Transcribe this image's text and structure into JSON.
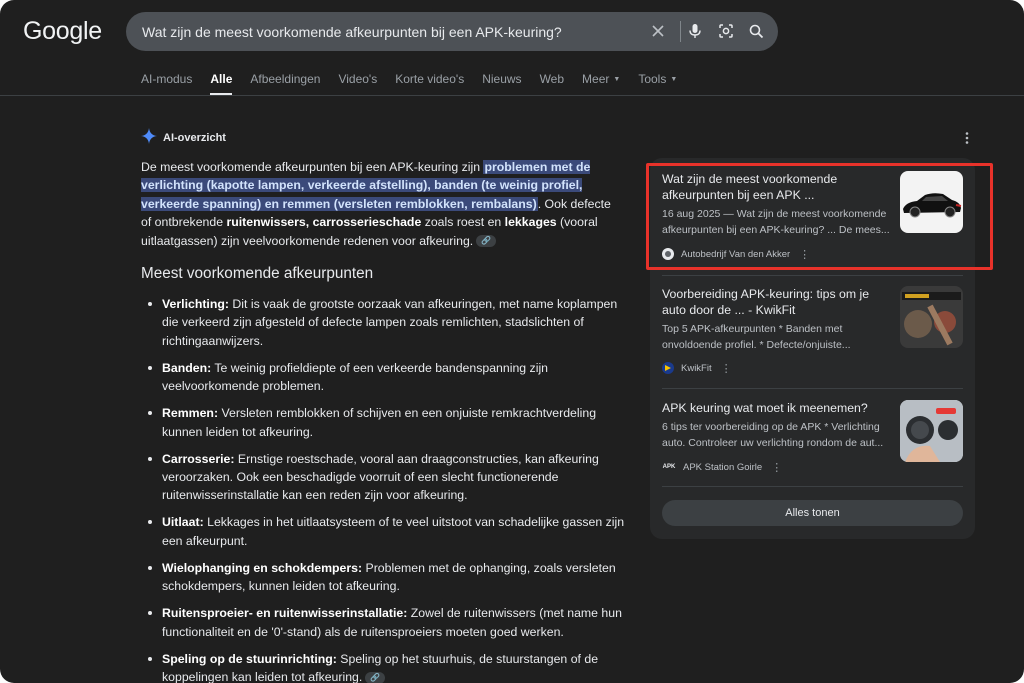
{
  "header": {
    "logo": "Google",
    "search_value": "Wat zijn de meest voorkomende afkeurpunten bij een APK-keuring?"
  },
  "tabs": [
    {
      "label": "AI-modus"
    },
    {
      "label": "Alle",
      "active": true
    },
    {
      "label": "Afbeeldingen"
    },
    {
      "label": "Video's"
    },
    {
      "label": "Korte video's"
    },
    {
      "label": "Nieuws"
    },
    {
      "label": "Web"
    },
    {
      "label": "Meer",
      "caret": true
    },
    {
      "label": "Tools",
      "caret": true
    }
  ],
  "ai_overview": {
    "title": "AI-overzicht",
    "summary": {
      "p1": "De meest voorkomende afkeurpunten bij een APK-keuring zijn ",
      "hl": "problemen met de verlichting (kapotte lampen, verkeerde afstelling), banden (te weinig profiel, verkeerde spanning) en remmen (versleten remblokken, rembalans)",
      "p2": ". Ook defecte of ontbrekende ",
      "b1": "ruitenwissers, carrosserieschade",
      "p3": " zoals roest en ",
      "b2": "lekkages",
      "p4": " (vooral uitlaatgassen) zijn veelvoorkomende redenen voor afkeuring."
    },
    "section_title": "Meest voorkomende afkeurpunten",
    "points": [
      {
        "term": "Verlichting:",
        "text": " Dit is vaak de grootste oorzaak van afkeuringen, met name koplampen die verkeerd zijn afgesteld of defecte lampen zoals remlichten, stadslichten of richtingaanwijzers."
      },
      {
        "term": "Banden:",
        "text": " Te weinig profieldiepte of een verkeerde bandenspanning zijn veelvoorkomende problemen."
      },
      {
        "term": "Remmen:",
        "text": " Versleten remblokken of schijven en een onjuiste remkrachtverdeling kunnen leiden tot afkeuring."
      },
      {
        "term": "Carrosserie:",
        "text": " Ernstige roestschade, vooral aan draagconstructies, kan afkeuring veroorzaken. Ook een beschadigde voorruit of een slecht functionerende ruitenwisserinstallatie kan een reden zijn voor afkeuring."
      },
      {
        "term": "Uitlaat:",
        "text": " Lekkages in het uitlaatsysteem of te veel uitstoot van schadelijke gassen zijn een afkeurpunt."
      },
      {
        "term": "Wielophanging en schokdempers:",
        "text": " Problemen met de ophanging, zoals versleten schokdempers, kunnen leiden tot afkeuring."
      },
      {
        "term": "Ruitensproeier- en ruitenwisserinstallatie:",
        "text": " Zowel de ruitenwissers (met name hun functionaliteit en de '0'-stand) als de ruitensproeiers moeten goed werken."
      },
      {
        "term": "Speling op de stuurinrichting:",
        "text": " Speling op het stuurhuis, de stuurstangen of de koppelingen kan leiden tot afkeuring."
      }
    ]
  },
  "sources": [
    {
      "title": "Wat zijn de meest voorkomende afkeurpunten bij een APK ...",
      "snippet": "16 aug 2025 — Wat zijn de meest voorkomende afkeurpunten bij een APK-keuring? ... De mees...",
      "site": "Autobedrijf Van den Akker"
    },
    {
      "title": "Voorbereiding APK-keuring: tips om je auto door de ... - KwikFit",
      "snippet": "Top 5 APK-afkeurpunten * Banden met onvoldoende profiel. * Defecte/onjuiste...",
      "site": "KwikFit"
    },
    {
      "title": "APK keuring wat moet ik meenemen?",
      "snippet": "6 tips ter voorbereiding op de APK * Verlichting auto. Controleer uw verlichting rondom de aut...",
      "site": "APK Station Goirle"
    }
  ],
  "show_all_label": "Alles tonen",
  "colors": {
    "background": "#1f1f1f",
    "panel": "#28292a",
    "highlight": "#3b4a7a",
    "annotation_box": "#e8322a",
    "ai_star_blue": "#4f8bf9"
  }
}
